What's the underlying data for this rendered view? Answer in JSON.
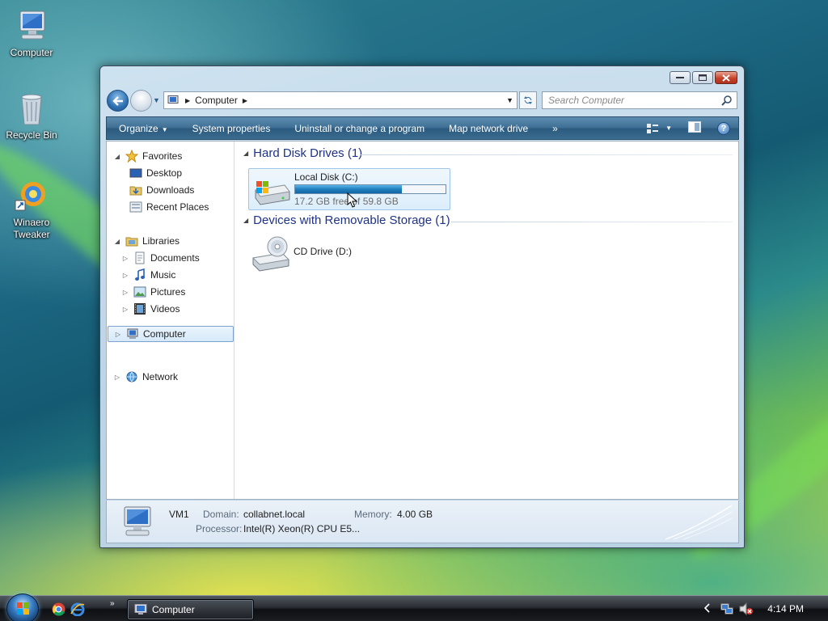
{
  "colors": {
    "accent": "#1e3287",
    "command_bar": "#3e6e93",
    "selection": "#d6e9f9",
    "bar_fill": "#1f7fbf"
  },
  "desktop": {
    "icons": [
      {
        "label": "Computer",
        "icon": "computer-icon"
      },
      {
        "label": "Recycle Bin",
        "icon": "recycle-bin-icon"
      },
      {
        "label": "Winaero Tweaker",
        "icon": "winaero-tweaker-icon"
      }
    ]
  },
  "window": {
    "address": {
      "location": "Computer"
    },
    "search": {
      "placeholder": "Search Computer"
    },
    "command_bar": {
      "organize": "Organize",
      "system_properties": "System properties",
      "uninstall": "Uninstall or change a program",
      "map_drive": "Map network drive",
      "overflow": "»"
    },
    "nav": {
      "favorites": "Favorites",
      "desktop": "Desktop",
      "downloads": "Downloads",
      "recent_places": "Recent Places",
      "libraries": "Libraries",
      "documents": "Documents",
      "music": "Music",
      "pictures": "Pictures",
      "videos": "Videos",
      "computer": "Computer",
      "network": "Network"
    },
    "groups": {
      "hdd": {
        "title": "Hard Disk Drives (1)"
      },
      "removable": {
        "title": "Devices with Removable Storage (1)"
      }
    },
    "drives": {
      "local_disk": {
        "name": "Local Disk (C:)",
        "free_text": "17.2 GB free of 59.8 GB",
        "used_fraction": 0.71
      },
      "cd_drive": {
        "name": "CD Drive (D:)"
      }
    },
    "details": {
      "name": "VM1",
      "domain_label": "Domain:",
      "domain_value": "collabnet.local",
      "memory_label": "Memory:",
      "memory_value": "4.00 GB",
      "processor_label": "Processor:",
      "processor_value": "Intel(R) Xeon(R) CPU E5..."
    }
  },
  "taskbar": {
    "active_window": "Computer",
    "clock": "4:14 PM",
    "overflow": "»"
  }
}
